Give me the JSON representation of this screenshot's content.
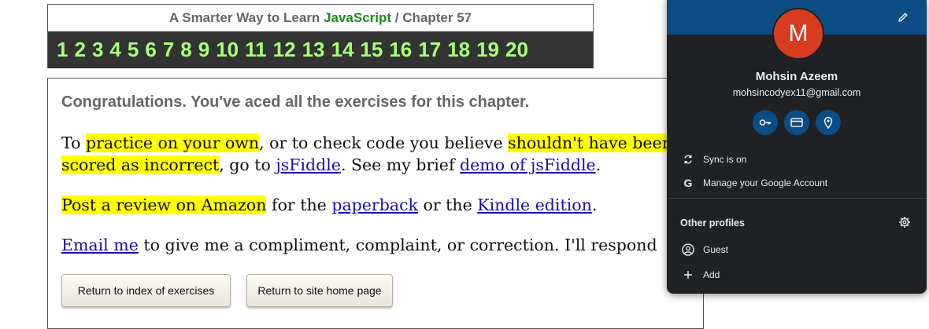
{
  "header": {
    "title_prefix": "A Smarter Way to Learn",
    "title_brand": "JavaScript",
    "title_separator": "/",
    "title_chapter": "Chapter 57",
    "chapters": [
      "1",
      "2",
      "3",
      "4",
      "5",
      "6",
      "7",
      "8",
      "9",
      "10",
      "11",
      "12",
      "13",
      "14",
      "15",
      "16",
      "17",
      "18",
      "19",
      "20"
    ]
  },
  "content": {
    "congrats": "Congratulations. You've aced all the exercises for this chapter.",
    "p1": {
      "t1": "To ",
      "h1": "practice on your own",
      "t2": ", or to check code you believe ",
      "h2a": "shouldn't have been",
      "h2b": "scored as incorrect",
      "t3": ", go to ",
      "link_jsfiddle": "jsFiddle",
      "t4": ". See my brief ",
      "link_demo": "demo of jsFiddle",
      "t5": "."
    },
    "p2": {
      "h1": "Post a review on Amazon",
      "t1": " for the ",
      "link_paperback": "paperback",
      "t2": " or the ",
      "link_kindle": "Kindle edition",
      "t3": "."
    },
    "p3": {
      "link_email": "Email me",
      "t1": " to give me a compliment, complaint, or correction. I'll respond"
    },
    "buttons": {
      "index": "Return to index of exercises",
      "home": "Return to site home page"
    }
  },
  "profile_popup": {
    "avatar_letter": "M",
    "name": "Mohsin Azeem",
    "email": "mohsincodyex11@gmail.com",
    "quick_actions": [
      "key-icon",
      "credit-card-icon",
      "location-pin-icon"
    ],
    "sync": "Sync is on",
    "manage": "Manage your Google Account",
    "other_profiles": "Other profiles",
    "guest": "Guest",
    "add": "Add"
  },
  "colors": {
    "highlight": "#ffff00",
    "link": "#1a0dab",
    "chapter_numbers": "#a8ff7a",
    "brand_green": "#1e8a1e",
    "popup_bg": "#202124",
    "popup_band": "#0b4d84",
    "avatar": "#d83c20"
  }
}
